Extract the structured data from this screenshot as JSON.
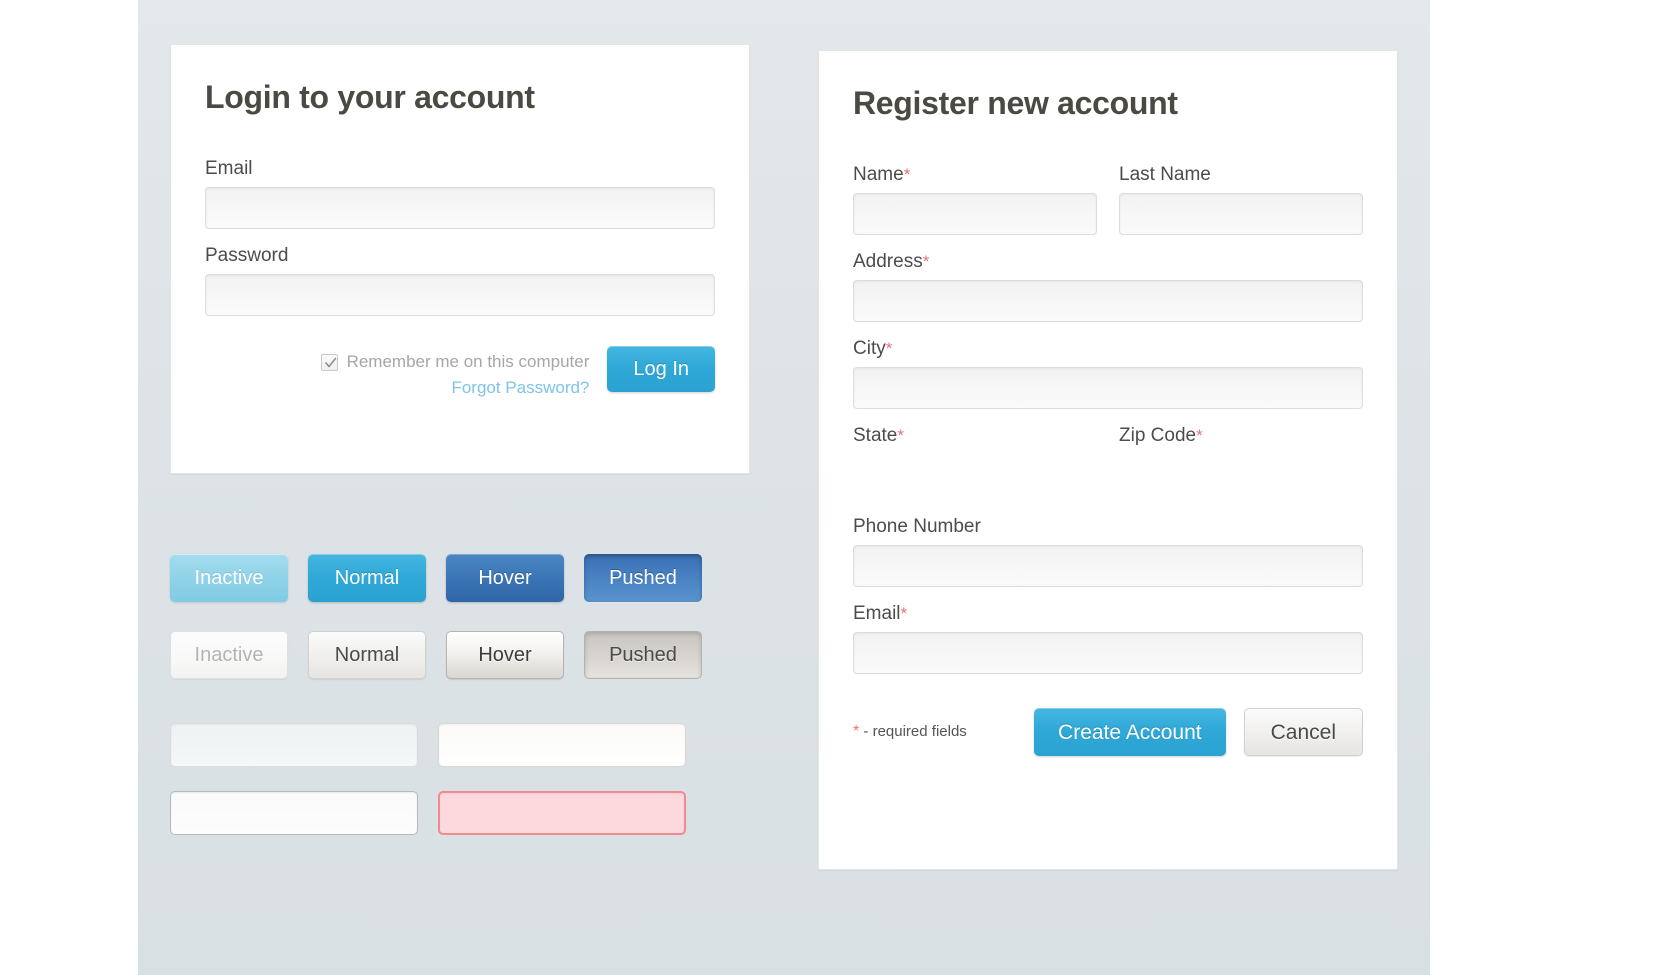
{
  "login": {
    "title": "Login to your account",
    "fields": [
      {
        "label": "Email",
        "value": "",
        "placeholder": ""
      },
      {
        "label": "Password",
        "value": "",
        "placeholder": ""
      }
    ],
    "remember": {
      "label": "Remember me on this computer",
      "checked": true,
      "check_icon": "checkmark-icon"
    },
    "forgot_link": "Forgot Password?",
    "submit_label": "Log In"
  },
  "register": {
    "title": "Register new account",
    "required_marker": "*",
    "fields": [
      {
        "label": "Name",
        "required": true,
        "value": "",
        "has_input": true
      },
      {
        "label": "Last Name",
        "required": false,
        "value": "",
        "has_input": true
      },
      {
        "label": "Address",
        "required": true,
        "value": "",
        "has_input": true
      },
      {
        "label": "City",
        "required": true,
        "value": "",
        "has_input": true
      },
      {
        "label": "State",
        "required": true,
        "value": "",
        "has_input": false
      },
      {
        "label": "Zip Code",
        "required": true,
        "value": "",
        "has_input": false
      },
      {
        "label": "Phone Number",
        "required": false,
        "value": "",
        "has_input": true
      },
      {
        "label": "Email",
        "required": true,
        "value": "",
        "has_input": true
      }
    ],
    "required_note": "- required fields",
    "create_label": "Create Account",
    "cancel_label": "Cancel"
  },
  "swatches": {
    "blue_buttons": [
      {
        "label": "Inactive",
        "state": "inactive"
      },
      {
        "label": "Normal",
        "state": "normal"
      },
      {
        "label": "Hover",
        "state": "hover"
      },
      {
        "label": "Pushed",
        "state": "pushed"
      }
    ],
    "grey_buttons": [
      {
        "label": "Inactive",
        "state": "inactive"
      },
      {
        "label": "Normal",
        "state": "normal"
      },
      {
        "label": "Hover",
        "state": "hover"
      },
      {
        "label": "Pushed",
        "state": "pushed"
      }
    ],
    "input_states": [
      {
        "state": "normal"
      },
      {
        "state": "hover"
      },
      {
        "state": "focus"
      },
      {
        "state": "error"
      }
    ]
  },
  "colors": {
    "accent_blue": "#2ea8d8",
    "blue_hover": "#3a73b4",
    "blue_inactive": "#8ed2e8",
    "link_blue": "#7fc4e8",
    "required_red": "#e8727c",
    "error_bg": "#fbd9dc",
    "error_border": "#f08a92",
    "canvas": "#dde3e6",
    "card_bg": "#ffffff",
    "heading": "#4a4a42",
    "label": "#4c4c4c",
    "muted_text": "#a6a6a6"
  }
}
